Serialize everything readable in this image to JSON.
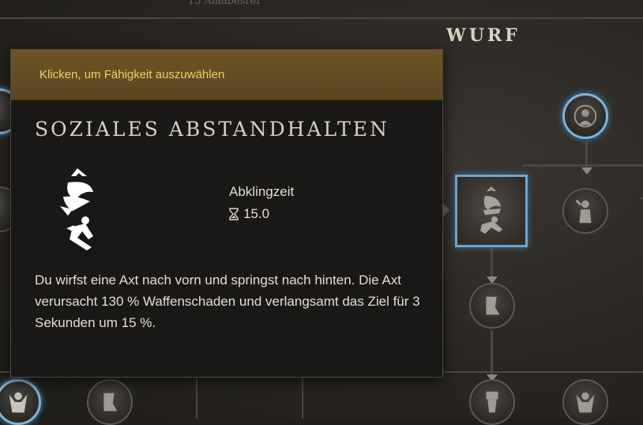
{
  "tree": {
    "section_title": "WURF",
    "top_faint_text": "15  Alaabesrer"
  },
  "tooltip": {
    "header_hint": "Klicken, um Fähigkeit auszuwählen",
    "ability_name": "SOZIALES ABSTANDHALTEN",
    "cooldown_label": "Abklingzeit",
    "cooldown_value": "15.0",
    "description": "Du wirfst eine Axt nach vorn und springst nach hinten. Die Axt verursacht 130 % Waffenschaden und verlangsamt das Ziel für 3 Sekunden um 15 %."
  },
  "colors": {
    "accent_gold": "#f0cf62",
    "selected_blue": "#7fb3d8",
    "header_brown": "#6e5526"
  },
  "icons": [
    "axe-throw-leap-icon",
    "hourglass-icon",
    "ability-node-icon"
  ]
}
